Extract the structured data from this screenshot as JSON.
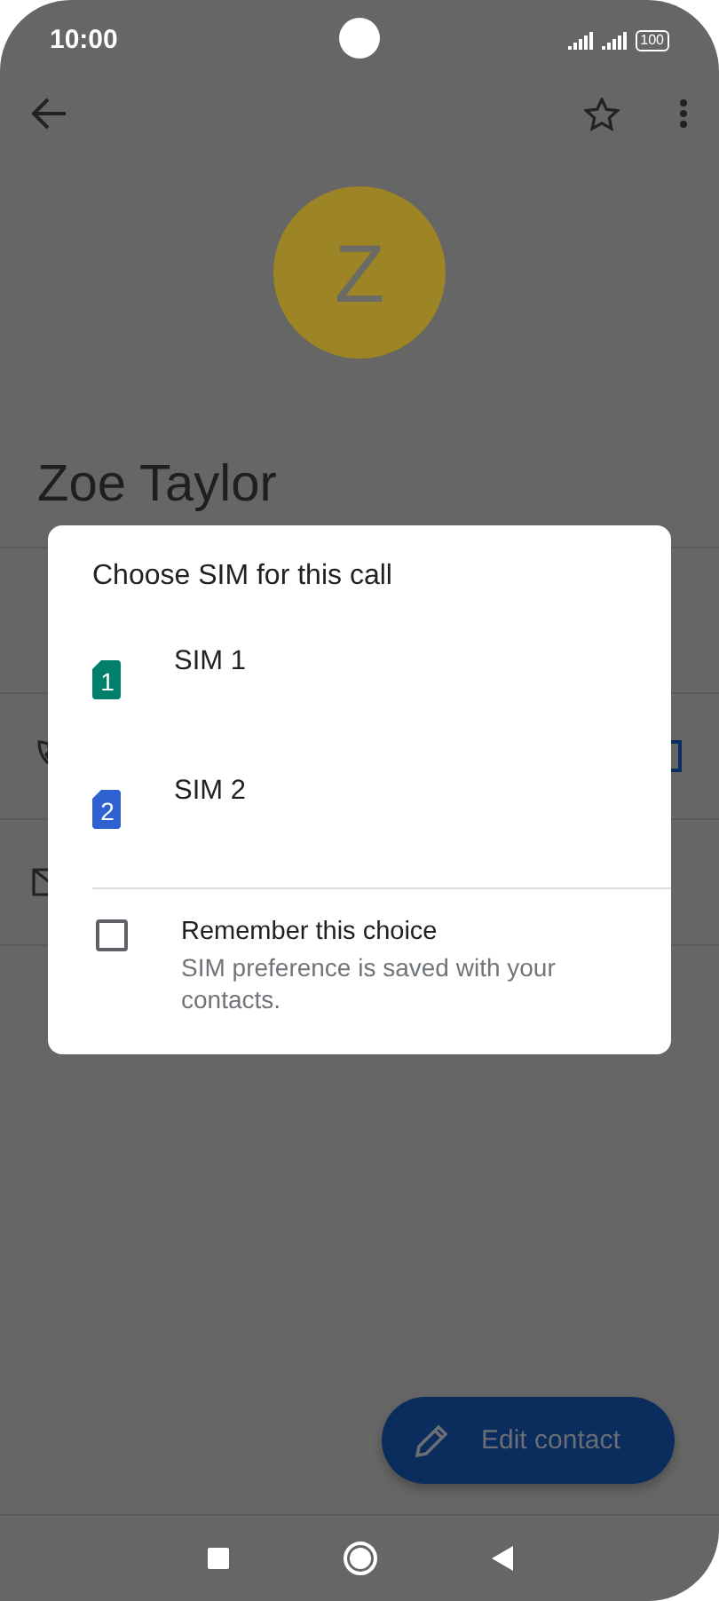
{
  "status_bar": {
    "time": "10:00",
    "battery": "100"
  },
  "contact": {
    "avatar_letter": "Z",
    "name": "Zoe Taylor"
  },
  "dialog": {
    "title": "Choose SIM for this call",
    "sims": [
      {
        "label": "SIM 1",
        "badge": "1",
        "color": "#00806a"
      },
      {
        "label": "SIM 2",
        "badge": "2",
        "color": "#2f62d0"
      }
    ],
    "remember": {
      "label": "Remember this choice",
      "hint": "SIM preference is saved with your contacts.",
      "checked": false
    }
  },
  "fab": {
    "label": "Edit contact"
  }
}
